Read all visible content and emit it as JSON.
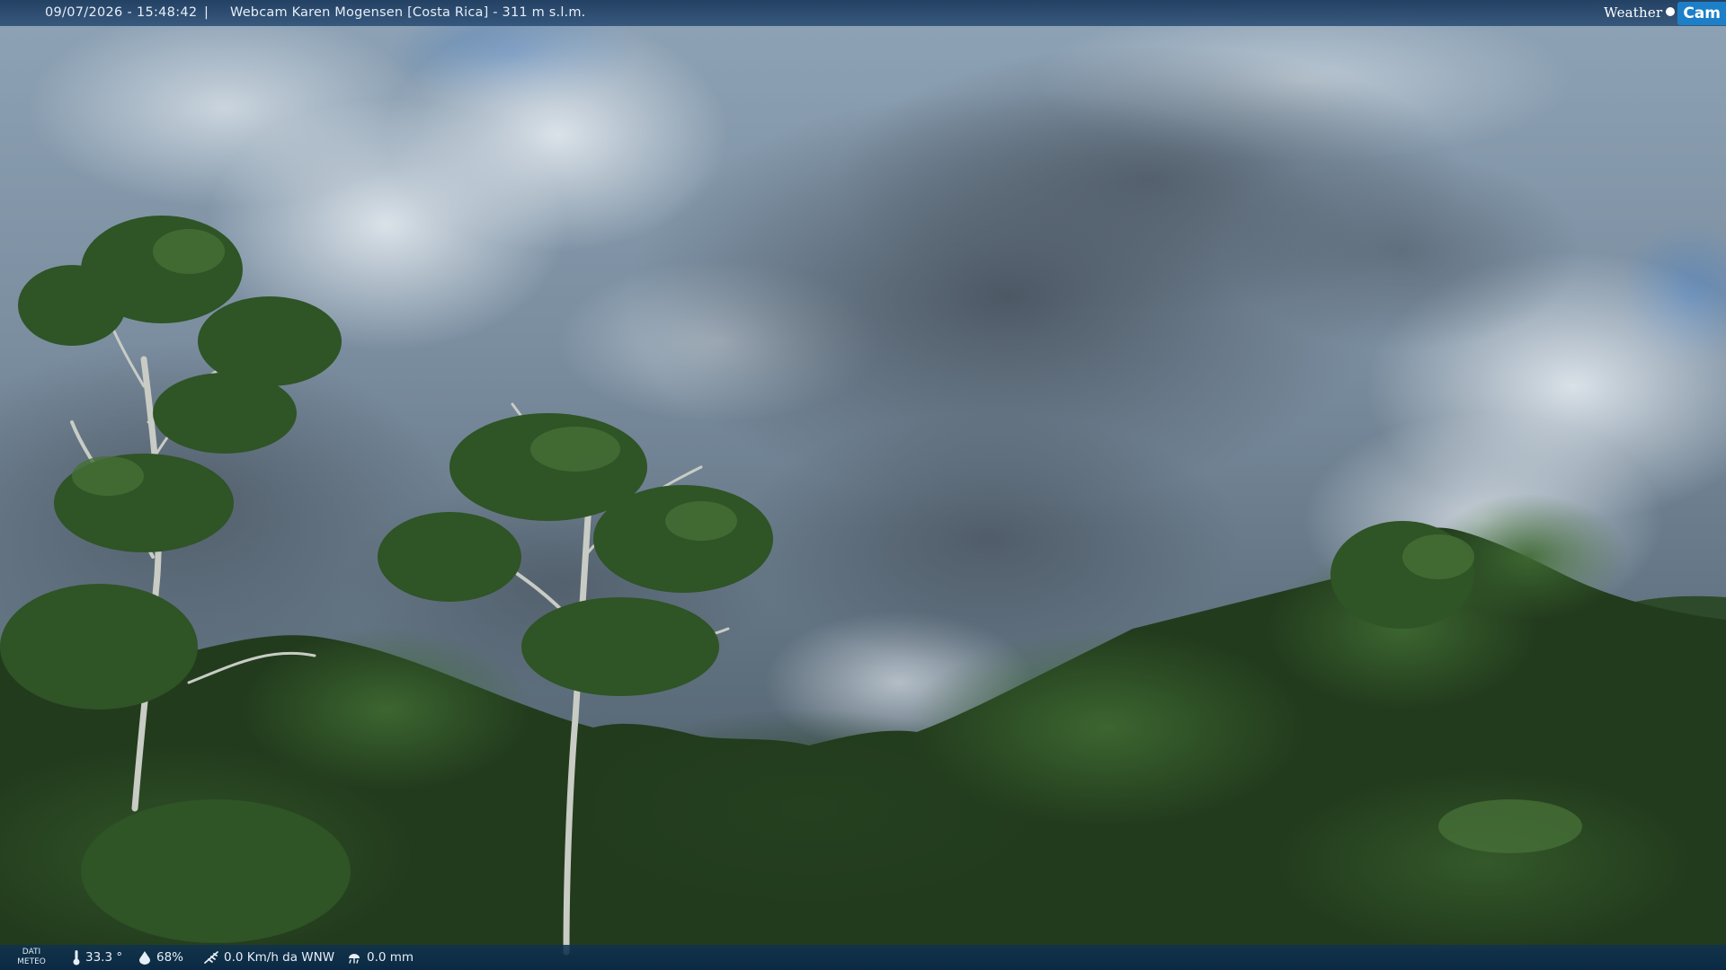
{
  "header": {
    "datetime": "09/07/2026 - 15:48:42",
    "separator": "|",
    "title": "Webcam Karen Mogensen [Costa Rica]  - 311 m s.l.m."
  },
  "logo": {
    "text_weather": "Weather",
    "text_cam": "Cam"
  },
  "footer": {
    "dati_line1": "DATI",
    "dati_line2": "METEO",
    "temperature": "33.3 °",
    "humidity": "68%",
    "wind": "0.0 Km/h da WNW",
    "rain": "0.0 mm"
  },
  "colors": {
    "bar_top": "#1e3c5f",
    "bar_bottom": "#0a2846",
    "logo_accent": "#1d7fc8"
  },
  "icons": {
    "temperature": "thermometer-icon",
    "humidity": "droplet-icon",
    "wind": "wind-icon",
    "rain": "rain-icon"
  }
}
